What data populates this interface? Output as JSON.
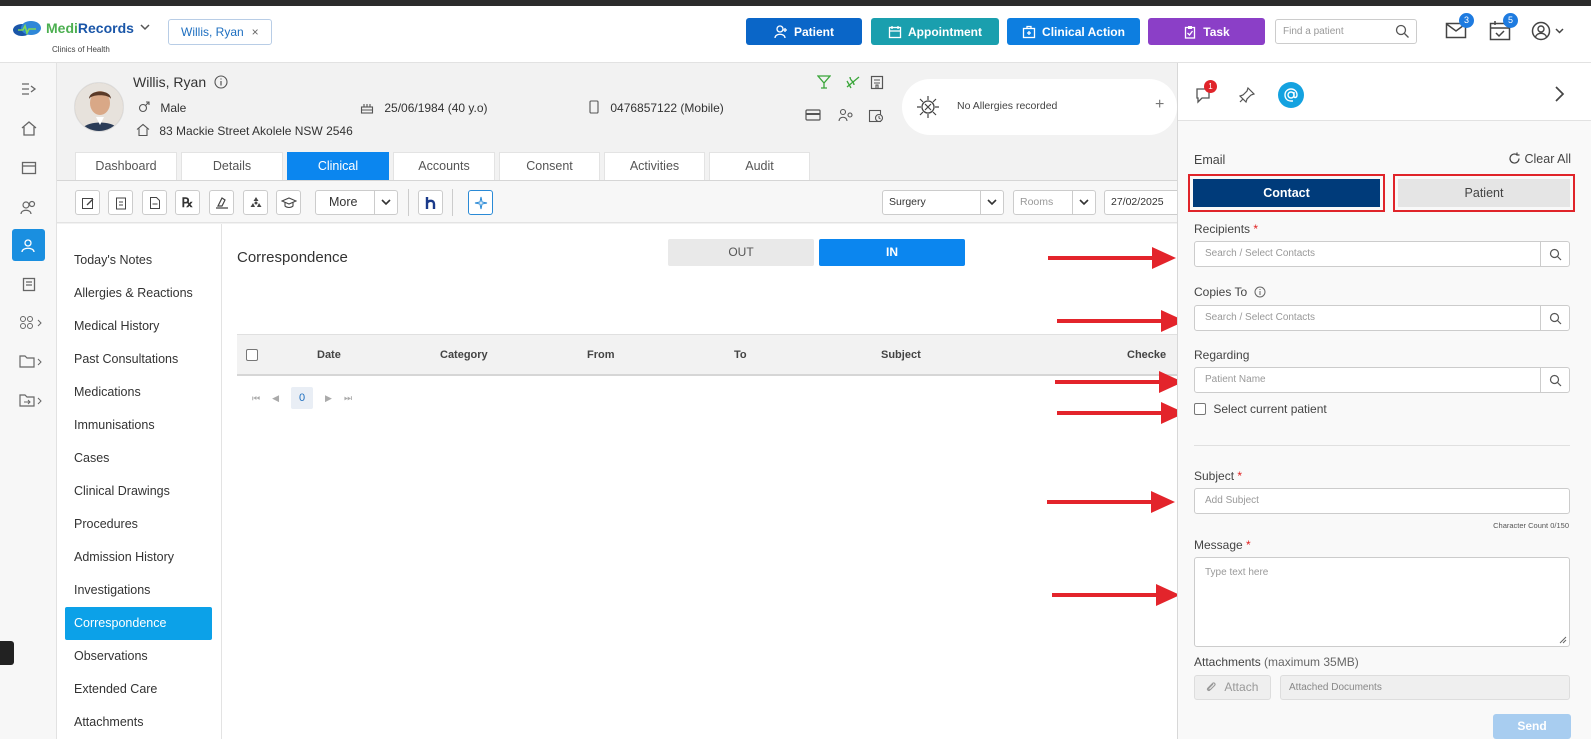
{
  "app": {
    "brand_medi": "Medi",
    "brand_records": "Records",
    "subtitle": "Clinics of Health"
  },
  "open_patient_tab": {
    "label": "Willis, Ryan",
    "close": "×"
  },
  "top_buttons": [
    {
      "label": "Patient",
      "color": "#0a66c8",
      "icon": "person-add-icon"
    },
    {
      "label": "Appointment",
      "color": "#1a9fae",
      "icon": "calendar-icon"
    },
    {
      "label": "Clinical Action",
      "color": "#0d7ee0",
      "icon": "briefcase-medical-icon"
    },
    {
      "label": "Task",
      "color": "#8b3fc7",
      "icon": "clipboard-icon"
    }
  ],
  "find_patient": {
    "placeholder": "Find a patient"
  },
  "notifications": {
    "mail_count": "3",
    "tasks_count": "5"
  },
  "patient": {
    "name": "Willis, Ryan",
    "gender": "Male",
    "dob": "25/06/1984 (40 y.o)",
    "phone": "0476857122 (Mobile)",
    "address": "83 Mackie Street Akolele NSW 2546",
    "allergies": "No Allergies recorded"
  },
  "tabs": [
    {
      "label": "Dashboard",
      "active": false
    },
    {
      "label": "Details",
      "active": false
    },
    {
      "label": "Clinical",
      "active": true
    },
    {
      "label": "Accounts",
      "active": false
    },
    {
      "label": "Consent",
      "active": false
    },
    {
      "label": "Activities",
      "active": false
    },
    {
      "label": "Audit",
      "active": false
    }
  ],
  "toolbar": {
    "more": "More",
    "location": "Surgery",
    "rooms": "Rooms",
    "date": "27/02/2025"
  },
  "clinical_nav": [
    {
      "label": "Today's Notes",
      "active": false
    },
    {
      "label": "Allergies & Reactions",
      "active": false
    },
    {
      "label": "Medical History",
      "active": false
    },
    {
      "label": "Past Consultations",
      "active": false
    },
    {
      "label": "Medications",
      "active": false
    },
    {
      "label": "Immunisations",
      "active": false
    },
    {
      "label": "Cases",
      "active": false
    },
    {
      "label": "Clinical Drawings",
      "active": false
    },
    {
      "label": "Procedures",
      "active": false
    },
    {
      "label": "Admission History",
      "active": false
    },
    {
      "label": "Investigations",
      "active": false
    },
    {
      "label": "Correspondence",
      "active": true
    },
    {
      "label": "Observations",
      "active": false
    },
    {
      "label": "Extended Care",
      "active": false
    },
    {
      "label": "Attachments",
      "active": false
    }
  ],
  "correspondence": {
    "title": "Correspondence",
    "out_label": "OUT",
    "in_label": "IN",
    "columns": [
      "Date",
      "Category",
      "From",
      "To",
      "Subject",
      "Checke"
    ],
    "page": "0"
  },
  "email_panel": {
    "chat_badge": "1",
    "title": "Email",
    "clear_all": "Clear All",
    "contact_btn": "Contact",
    "patient_btn": "Patient",
    "recipients_label": "Recipients",
    "recipients_placeholder": "Search / Select Contacts",
    "copies_label": "Copies To",
    "copies_placeholder": "Search / Select Contacts",
    "regarding_label": "Regarding",
    "regarding_placeholder": "Patient Name",
    "select_current": "Select current patient",
    "subject_label": "Subject",
    "subject_placeholder": "Add Subject",
    "char_count": "Character Count 0/150",
    "message_label": "Message",
    "message_placeholder": "Type text here",
    "attachments_label": "Attachments",
    "attachments_note": "(maximum 35MB)",
    "attach_btn": "Attach",
    "attached_docs": "Attached Documents",
    "send_btn": "Send",
    "required_mark": "*"
  },
  "colors": {
    "primary": "#0b86ef",
    "dark_blue": "#003b7a",
    "annotation_red": "#e3242b"
  }
}
